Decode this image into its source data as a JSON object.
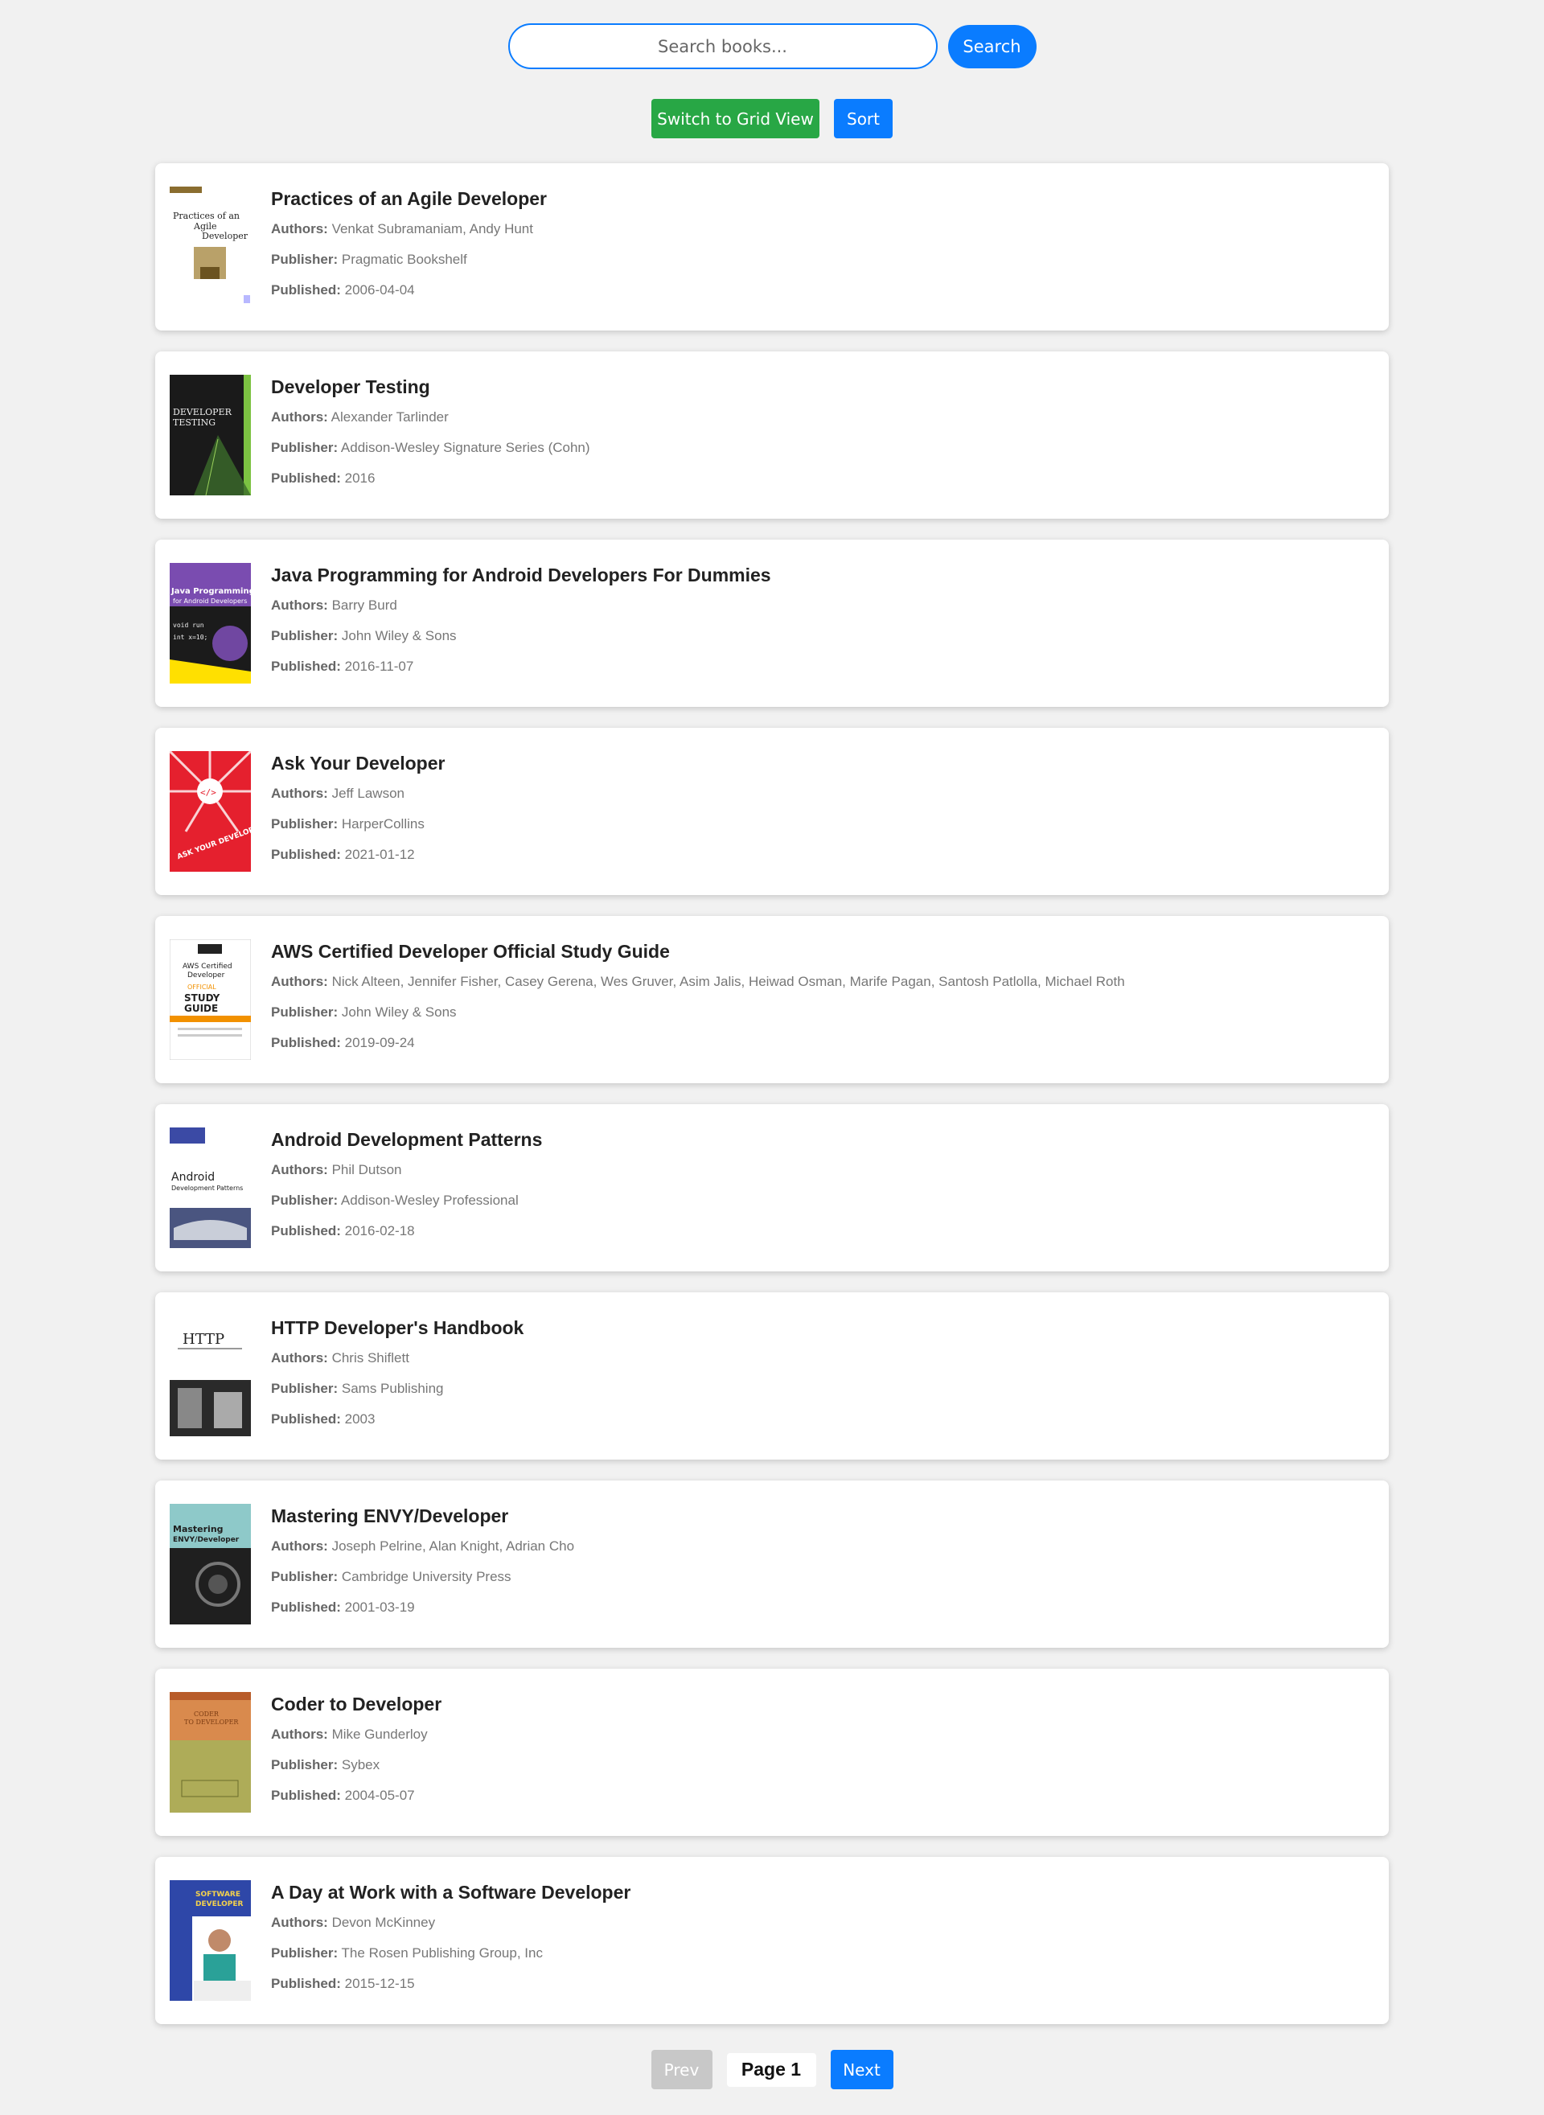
{
  "search": {
    "placeholder": "Search books...",
    "value": "",
    "button_label": "Search"
  },
  "controls": {
    "grid_view_label": "Switch to Grid View",
    "sort_label": "Sort"
  },
  "labels": {
    "authors": "Authors:",
    "publisher": "Publisher:",
    "published": "Published:"
  },
  "books": [
    {
      "title": "Practices of an Agile Developer",
      "authors": "Venkat Subramaniam, Andy Hunt",
      "publisher": "Pragmatic Bookshelf",
      "published": "2006-04-04"
    },
    {
      "title": "Developer Testing",
      "authors": "Alexander Tarlinder",
      "publisher": "Addison-Wesley Signature Series (Cohn)",
      "published": "2016"
    },
    {
      "title": "Java Programming for Android Developers For Dummies",
      "authors": "Barry Burd",
      "publisher": "John Wiley & Sons",
      "published": "2016-11-07"
    },
    {
      "title": "Ask Your Developer",
      "authors": "Jeff Lawson",
      "publisher": "HarperCollins",
      "published": "2021-01-12"
    },
    {
      "title": "AWS Certified Developer Official Study Guide",
      "authors": "Nick Alteen, Jennifer Fisher, Casey Gerena, Wes Gruver, Asim Jalis, Heiwad Osman, Marife Pagan, Santosh Patlolla, Michael Roth",
      "publisher": "John Wiley & Sons",
      "published": "2019-09-24"
    },
    {
      "title": "Android Development Patterns",
      "authors": "Phil Dutson",
      "publisher": "Addison-Wesley Professional",
      "published": "2016-02-18"
    },
    {
      "title": "HTTP Developer's Handbook",
      "authors": "Chris Shiflett",
      "publisher": "Sams Publishing",
      "published": "2003"
    },
    {
      "title": "Mastering ENVY/Developer",
      "authors": "Joseph Pelrine, Alan Knight, Adrian Cho",
      "publisher": "Cambridge University Press",
      "published": "2001-03-19"
    },
    {
      "title": "Coder to Developer",
      "authors": "Mike Gunderloy",
      "publisher": "Sybex",
      "published": "2004-05-07"
    },
    {
      "title": "A Day at Work with a Software Developer",
      "authors": "Devon McKinney",
      "publisher": "The Rosen Publishing Group, Inc",
      "published": "2015-12-15"
    }
  ],
  "covers": [
    {
      "icon": "book-cover-practices-agile-developer",
      "bg": "#ffffff",
      "accent": "#8a6d2f",
      "text": "Practices of an Agile Developer"
    },
    {
      "icon": "book-cover-developer-testing",
      "bg": "#1a1a1a",
      "accent": "#7cc242",
      "text": "DEVELOPER TESTING"
    },
    {
      "icon": "book-cover-java-android-dummies",
      "bg": "#1b1b1b",
      "accent": "#ffe000",
      "text": "Java Programming for Android Developers dummies"
    },
    {
      "icon": "book-cover-ask-your-developer",
      "bg": "#e5202e",
      "accent": "#ffffff",
      "text": "ASK YOUR DEVELOPER"
    },
    {
      "icon": "book-cover-aws-study-guide",
      "bg": "#ffffff",
      "accent": "#f29100",
      "text": "AWS Certified Developer OFFICIAL STUDY GUIDE"
    },
    {
      "icon": "book-cover-android-patterns",
      "bg": "#ffffff",
      "accent": "#3b4aa5",
      "text": "Android Development Patterns"
    },
    {
      "icon": "book-cover-http-handbook",
      "bg": "#ffffff",
      "accent": "#222222",
      "text": "HTTP"
    },
    {
      "icon": "book-cover-mastering-envy",
      "bg": "#8ec9c9",
      "accent": "#1f1f1f",
      "text": "Mastering ENVY/Developer"
    },
    {
      "icon": "book-cover-coder-to-developer",
      "bg": "#d98a4d",
      "accent": "#a6b25a",
      "text": "CODER TO DEVELOPER"
    },
    {
      "icon": "book-cover-day-at-work",
      "bg": "#2e47a8",
      "accent": "#ffffff",
      "text": "SOFTWARE DEVELOPER"
    }
  ],
  "pagination": {
    "prev_label": "Prev",
    "page_label": "Page 1",
    "next_label": "Next"
  },
  "colors": {
    "primary": "#0a7cff",
    "success": "#28a745",
    "disabled": "#c8c8c8",
    "background": "#f1f1f1"
  }
}
